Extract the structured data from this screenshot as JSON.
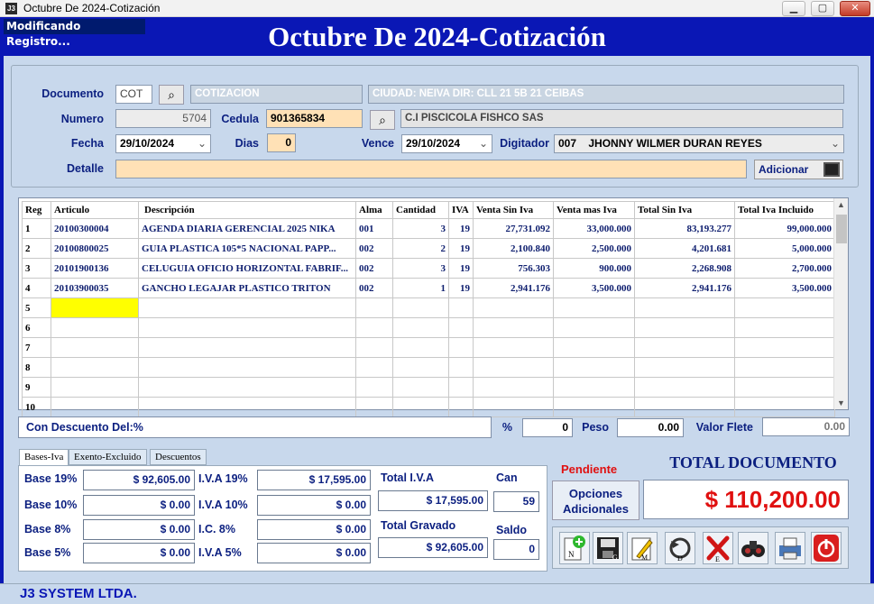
{
  "window": {
    "title": "Octubre De 2024-Cotización",
    "icon": "app-icon",
    "minimize": "▭",
    "maximize": "□",
    "close": "✕"
  },
  "header": {
    "status": "Modificando Registro...",
    "title": "Octubre De 2024-Cotización"
  },
  "form": {
    "documento_label": "Documento",
    "documento": "COT",
    "documento_desc": "COTIZACION",
    "ciudad": "CIUDAD: NEIVA DIR: CLL 21 5B 21 CEIBAS",
    "numero_label": "Numero",
    "numero": "5704",
    "cedula_label": "Cedula",
    "cedula": "901365834",
    "cliente": "C.I PISCICOLA FISHCO SAS",
    "fecha_label": "Fecha",
    "fecha": "29/10/2024",
    "dias_label": "Dias",
    "dias": "0",
    "vence_label": "Vence",
    "vence": "29/10/2024",
    "digitador_label": "Digitador",
    "digitador": "007    JHONNY WILMER DURAN REYES",
    "detalle_label": "Detalle",
    "detalle": "",
    "adicionar_label": "Adicionar"
  },
  "grid": {
    "columns": [
      "Reg",
      "Articulo",
      "Descripción",
      "Alma",
      "Cantidad",
      "IVA",
      "Venta Sin Iva",
      "Venta mas Iva",
      "Total Sin Iva",
      "Total Iva Incluido"
    ],
    "rows": [
      {
        "reg": "1",
        "articulo": "20100300004",
        "desc": "AGENDA DIARIA  GERENCIAL 2025 NIKA",
        "alma": "001",
        "cant": "3",
        "iva": "19",
        "vsi": "27,731.092",
        "vmi": "33,000.000",
        "tsi": "83,193.277",
        "tii": "99,000.000"
      },
      {
        "reg": "2",
        "articulo": "20100800025",
        "desc": "GUIA PLASTICA  105*5 NACIONAL PAPP...",
        "alma": "002",
        "cant": "2",
        "iva": "19",
        "vsi": "2,100.840",
        "vmi": "2,500.000",
        "tsi": "4,201.681",
        "tii": "5,000.000"
      },
      {
        "reg": "3",
        "articulo": "20101900136",
        "desc": "CELUGUIA OFICIO HORIZONTAL FABRIF...",
        "alma": "002",
        "cant": "3",
        "iva": "19",
        "vsi": "756.303",
        "vmi": "900.000",
        "tsi": "2,268.908",
        "tii": "2,700.000"
      },
      {
        "reg": "4",
        "articulo": "20103900035",
        "desc": "GANCHO LEGAJAR PLASTICO TRITON",
        "alma": "002",
        "cant": "1",
        "iva": "19",
        "vsi": "2,941.176",
        "vmi": "3,500.000",
        "tsi": "2,941.176",
        "tii": "3,500.000"
      },
      {
        "reg": "5",
        "articulo": "",
        "desc": "",
        "alma": "",
        "cant": "",
        "iva": "",
        "vsi": "",
        "vmi": "",
        "tsi": "",
        "tii": ""
      },
      {
        "reg": "6",
        "articulo": "",
        "desc": "",
        "alma": "",
        "cant": "",
        "iva": "",
        "vsi": "",
        "vmi": "",
        "tsi": "",
        "tii": ""
      },
      {
        "reg": "7",
        "articulo": "",
        "desc": "",
        "alma": "",
        "cant": "",
        "iva": "",
        "vsi": "",
        "vmi": "",
        "tsi": "",
        "tii": ""
      },
      {
        "reg": "8",
        "articulo": "",
        "desc": "",
        "alma": "",
        "cant": "",
        "iva": "",
        "vsi": "",
        "vmi": "",
        "tsi": "",
        "tii": ""
      },
      {
        "reg": "9",
        "articulo": "",
        "desc": "",
        "alma": "",
        "cant": "",
        "iva": "",
        "vsi": "",
        "vmi": "",
        "tsi": "",
        "tii": ""
      },
      {
        "reg": "10",
        "articulo": "",
        "desc": "",
        "alma": "",
        "cant": "",
        "iva": "",
        "vsi": "",
        "vmi": "",
        "tsi": "",
        "tii": ""
      }
    ]
  },
  "discount": {
    "label": "Con Descuento Del:%",
    "pct_label": "%",
    "pct": "0",
    "peso_label": "Peso",
    "peso": "0.00",
    "flete_label": "Valor Flete",
    "flete": "0.00"
  },
  "tabs": [
    "Bases-Iva",
    "Exento-Excluido",
    "Descuentos"
  ],
  "taxes": {
    "base19_label": "Base 19%",
    "base19": "$ 92,605.00",
    "base10_label": "Base 10%",
    "base10": "$ 0.00",
    "base8_label": "Base 8%",
    "base8": "$ 0.00",
    "base5_label": "Base 5%",
    "base5": "$ 0.00",
    "iva19_label": "I.V.A 19%",
    "iva19": "$ 17,595.00",
    "iva10_label": "I.V.A 10%",
    "iva10": "$ 0.00",
    "ic8_label": "I.C. 8%",
    "ic8": "$ 0.00",
    "iva5_label": "I.V.A 5%",
    "iva5": "$ 0.00",
    "total_iva_label": "Total I.V.A",
    "total_iva": "$ 17,595.00",
    "total_gravado_label": "Total Gravado",
    "total_gravado": "$ 92,605.00",
    "can_label": "Can",
    "can": "59",
    "saldo_label": "Saldo",
    "saldo": "0"
  },
  "totals": {
    "status": "Pendiente",
    "opciones_label": "Opciones Adicionales",
    "total_label": "TOTAL DOCUMENTO",
    "total": "$ 110,200.00"
  },
  "toolbar": [
    "new-doc-icon",
    "save-icon",
    "edit-icon",
    "undo-icon",
    "delete-icon",
    "search-icon",
    "print-icon",
    "power-icon"
  ],
  "footer": {
    "company": "J3 SYSTEM LTDA."
  }
}
